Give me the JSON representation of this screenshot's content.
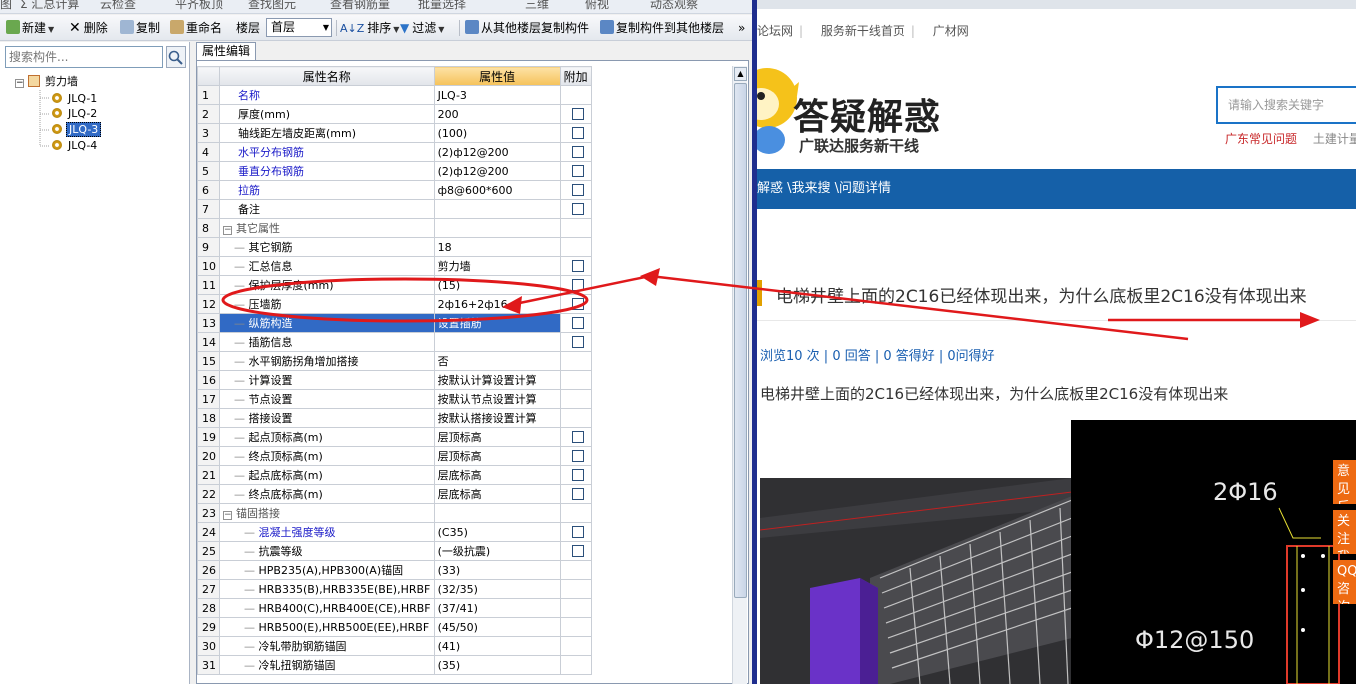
{
  "app": {
    "topcut": [
      "图",
      "Σ 汇总计算",
      "云检查",
      "平齐板顶",
      "查找图元",
      "查看钢筋量",
      "批量选择",
      "三维",
      "俯视",
      "动态观察"
    ],
    "toolbar": {
      "new_label": "新建",
      "delete_label": "删除",
      "copy_label": "复制",
      "rename_label": "重命名",
      "floor_label": "楼层",
      "floor_value": "首层",
      "sort_label": "排序",
      "filter_label": "过滤",
      "copy_from_label": "从其他楼层复制构件",
      "copy_to_label": "复制构件到其他楼层",
      "more": "»"
    },
    "tree": {
      "search_placeholder": "搜索构件...",
      "root": "剪力墙",
      "items": [
        "JLQ-1",
        "JLQ-2",
        "JLQ-3",
        "JLQ-4"
      ],
      "selected": "JLQ-3"
    },
    "property_editor": {
      "tab_label": "属性编辑",
      "headers": {
        "name": "属性名称",
        "value": "属性值",
        "extra": "附加"
      },
      "rows": [
        {
          "n": "1",
          "name": "名称",
          "value": "JLQ-3",
          "cb": false,
          "blue": true,
          "lvl": 0
        },
        {
          "n": "2",
          "name": "厚度(mm)",
          "value": "200",
          "cb": true,
          "blue": false,
          "lvl": 0
        },
        {
          "n": "3",
          "name": "轴线距左墙皮距离(mm)",
          "value": "(100)",
          "cb": true,
          "blue": false,
          "lvl": 0
        },
        {
          "n": "4",
          "name": "水平分布钢筋",
          "value": "(2)ф12@200",
          "cb": true,
          "blue": true,
          "lvl": 0
        },
        {
          "n": "5",
          "name": "垂直分布钢筋",
          "value": "(2)ф12@200",
          "cb": true,
          "blue": true,
          "lvl": 0
        },
        {
          "n": "6",
          "name": "拉筋",
          "value": "ф8@600*600",
          "cb": true,
          "blue": true,
          "lvl": 0
        },
        {
          "n": "7",
          "name": "备注",
          "value": "",
          "cb": true,
          "blue": false,
          "lvl": 0
        },
        {
          "n": "8",
          "name": "其它属性",
          "value": "",
          "cb": false,
          "blue": false,
          "lvl": -1
        },
        {
          "n": "9",
          "name": "其它钢筋",
          "value": "18",
          "cb": false,
          "blue": false,
          "lvl": 1
        },
        {
          "n": "10",
          "name": "汇总信息",
          "value": "剪力墙",
          "cb": true,
          "blue": false,
          "lvl": 1
        },
        {
          "n": "11",
          "name": "保护层厚度(mm)",
          "value": "(15)",
          "cb": true,
          "blue": false,
          "lvl": 1
        },
        {
          "n": "12",
          "name": "压墙筋",
          "value": "2ф16+2ф16",
          "cb": true,
          "blue": false,
          "lvl": 1
        },
        {
          "n": "13",
          "name": "纵筋构造",
          "value": "设置插筋",
          "cb": true,
          "blue": false,
          "lvl": 1,
          "sel": true
        },
        {
          "n": "14",
          "name": "插筋信息",
          "value": "",
          "cb": true,
          "blue": false,
          "lvl": 1
        },
        {
          "n": "15",
          "name": "水平钢筋拐角增加搭接",
          "value": "否",
          "cb": false,
          "blue": false,
          "lvl": 1
        },
        {
          "n": "16",
          "name": "计算设置",
          "value": "按默认计算设置计算",
          "cb": false,
          "blue": false,
          "lvl": 1
        },
        {
          "n": "17",
          "name": "节点设置",
          "value": "按默认节点设置计算",
          "cb": false,
          "blue": false,
          "lvl": 1
        },
        {
          "n": "18",
          "name": "搭接设置",
          "value": "按默认搭接设置计算",
          "cb": false,
          "blue": false,
          "lvl": 1
        },
        {
          "n": "19",
          "name": "起点顶标高(m)",
          "value": "层顶标高",
          "cb": true,
          "blue": false,
          "lvl": 1
        },
        {
          "n": "20",
          "name": "终点顶标高(m)",
          "value": "层顶标高",
          "cb": true,
          "blue": false,
          "lvl": 1
        },
        {
          "n": "21",
          "name": "起点底标高(m)",
          "value": "层底标高",
          "cb": true,
          "blue": false,
          "lvl": 1
        },
        {
          "n": "22",
          "name": "终点底标高(m)",
          "value": "层底标高",
          "cb": true,
          "blue": false,
          "lvl": 1
        },
        {
          "n": "23",
          "name": "锚固搭接",
          "value": "",
          "cb": false,
          "blue": false,
          "lvl": -1
        },
        {
          "n": "24",
          "name": "混凝土强度等级",
          "value": "(C35)",
          "cb": true,
          "blue": true,
          "lvl": 2
        },
        {
          "n": "25",
          "name": "抗震等级",
          "value": "(一级抗震)",
          "cb": true,
          "blue": false,
          "lvl": 2
        },
        {
          "n": "26",
          "name": "HPB235(A),HPB300(A)锚固",
          "value": "(33)",
          "cb": false,
          "blue": false,
          "lvl": 2
        },
        {
          "n": "27",
          "name": "HRB335(B),HRB335E(BE),HRBF",
          "value": "(32/35)",
          "cb": false,
          "blue": false,
          "lvl": 2
        },
        {
          "n": "28",
          "name": "HRB400(C),HRB400E(CE),HRBF",
          "value": "(37/41)",
          "cb": false,
          "blue": false,
          "lvl": 2
        },
        {
          "n": "29",
          "name": "HRB500(E),HRB500E(EE),HRBF",
          "value": "(45/50)",
          "cb": false,
          "blue": false,
          "lvl": 2
        },
        {
          "n": "30",
          "name": "冷轧带肋钢筋锚固",
          "value": "(41)",
          "cb": false,
          "blue": false,
          "lvl": 2
        },
        {
          "n": "31",
          "name": "冷轧扭钢筋锚固",
          "value": "(35)",
          "cb": false,
          "blue": false,
          "lvl": 2
        }
      ]
    }
  },
  "web": {
    "top_links": [
      "论坛网",
      "服务新干线首页",
      "广材网"
    ],
    "logo_title": "答疑解惑",
    "logo_subtitle": "广联达服务新干线",
    "search_placeholder": "请输入搜索关键字",
    "hot_links": [
      "广东常见问题",
      "土建计量"
    ],
    "breadcrumb": "解惑 \\我来搜 \\问题详情",
    "question_title": "电梯井壁上面的2C16已经体现出来，为什么底板里2C16没有体现出来",
    "stats": "浏览10 次 | 0 回答 | 0 答得好 | 0问得好",
    "question_body": "电梯井壁上面的2C16已经体现出来，为什么底板里2C16没有体现出来",
    "drawing_label_1": "2Φ16",
    "drawing_label_2": "Φ12@150",
    "float_buttons": [
      "意见反馈",
      "关注我们",
      "QQ咨询"
    ]
  },
  "colors": {
    "nav_blue": "#1560a8",
    "annotation_red": "#e0191b",
    "selection_blue": "#316ac5",
    "value_header": "#f5c25a"
  }
}
